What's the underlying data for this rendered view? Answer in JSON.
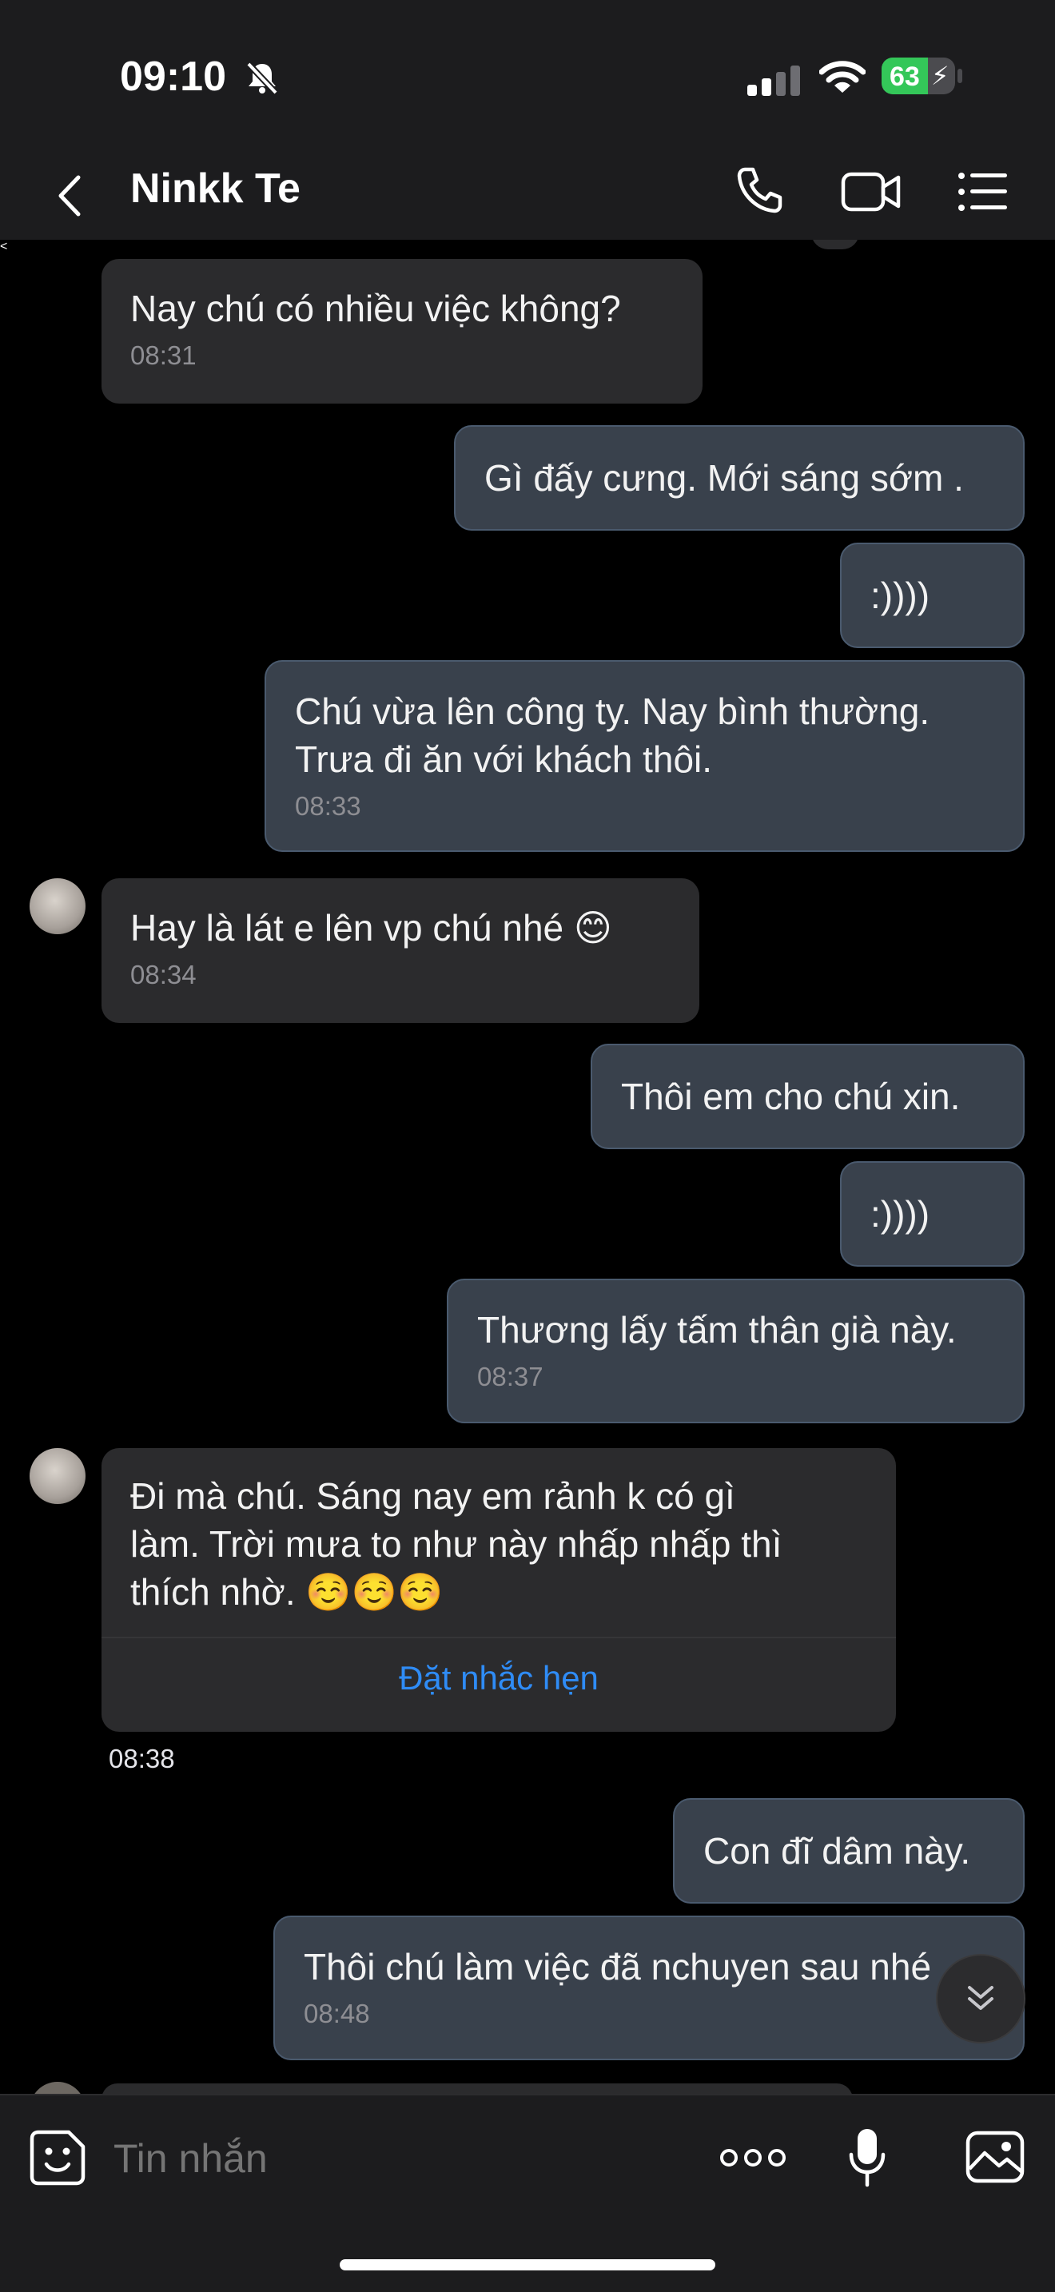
{
  "status_bar": {
    "time": "09:10",
    "battery": "63"
  },
  "header": {
    "contact_name": "Ninkk Te"
  },
  "messages": [
    {
      "dir": "in",
      "text": "Nay chú có nhiều việc không?",
      "time": "08:31"
    },
    {
      "dir": "out",
      "text": "Gì đấy cưng. Mới sáng sớm .",
      "time": ""
    },
    {
      "dir": "out",
      "text": ":))))",
      "time": ""
    },
    {
      "dir": "out",
      "text": "Chú vừa lên công ty. Nay bình thường.\nTrưa đi ăn với khách thôi.",
      "time": "08:33"
    },
    {
      "dir": "in",
      "text": "Hay là lát e lên vp chú nhé 😊",
      "time": "08:34"
    },
    {
      "dir": "out",
      "text": "Thôi em cho chú xin.",
      "time": ""
    },
    {
      "dir": "out",
      "text": ":))))",
      "time": ""
    },
    {
      "dir": "out",
      "text": "Thương lấy tấm thân già này.",
      "time": "08:37"
    },
    {
      "dir": "in",
      "text": "Đi mà chú. Sáng nay em rảnh k có gì\nlàm.   Trời mưa to như này nhấp nhấp thì\nthích nhờ. ☺️☺️☺️",
      "time": "08:38",
      "action": "Đặt nhắc hẹn"
    },
    {
      "dir": "out",
      "text": "Con đĩ dâm này.",
      "time": ""
    },
    {
      "dir": "out",
      "text": "Thôi chú làm việc đã nchuyen sau nhé",
      "time": "08:48"
    }
  ],
  "composer": {
    "placeholder": "Tin nhắn"
  },
  "colors": {
    "accent": "#2f8cf6",
    "battery": "#34c759"
  }
}
